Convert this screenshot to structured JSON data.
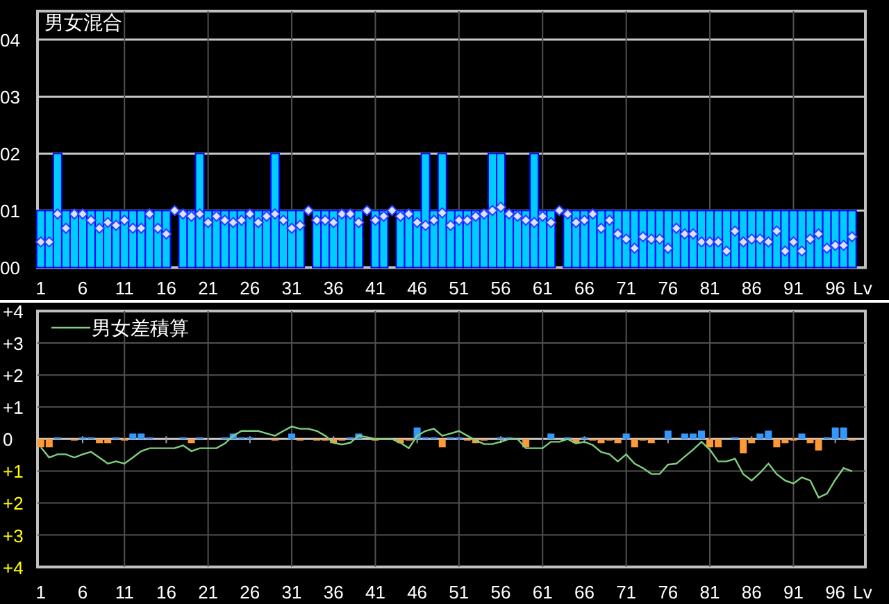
{
  "panels": [
    {
      "chart_data": {
        "type": "bar",
        "title": "男女混合",
        "grid": true,
        "x": [
          1,
          2,
          3,
          4,
          5,
          6,
          7,
          8,
          9,
          10,
          11,
          12,
          13,
          14,
          15,
          16,
          17,
          18,
          19,
          20,
          21,
          22,
          23,
          24,
          25,
          26,
          27,
          28,
          29,
          30,
          31,
          32,
          33,
          34,
          35,
          36,
          37,
          38,
          39,
          40,
          41,
          42,
          43,
          44,
          45,
          46,
          47,
          48,
          49,
          50,
          51,
          52,
          53,
          54,
          55,
          56,
          57,
          58,
          59,
          60,
          61,
          62,
          63,
          64,
          65,
          66,
          67,
          68,
          69,
          70,
          71,
          72,
          73,
          74,
          75,
          76,
          77,
          78,
          79,
          80,
          81,
          82,
          83,
          84,
          85,
          86,
          87,
          88,
          89,
          90,
          91,
          92,
          93,
          94,
          95,
          96,
          97,
          98
        ],
        "xlim": [
          0.6,
          99.6
        ],
        "xticks": [
          1,
          6,
          11,
          16,
          21,
          26,
          31,
          36,
          41,
          46,
          51,
          56,
          61,
          66,
          71,
          76,
          81,
          86,
          91,
          96
        ],
        "xlabel": "Lv",
        "ylim": [
          0,
          4.5
        ],
        "yticks": [
          {
            "value": 0,
            "label": "00"
          },
          {
            "value": 1,
            "label": "01"
          },
          {
            "value": 2,
            "label": "02"
          },
          {
            "value": 3,
            "label": "03"
          },
          {
            "value": 4,
            "label": "04"
          }
        ],
        "series": [
          {
            "color": "#00ccff",
            "values": [
              1,
              1,
              2,
              1,
              1,
              1,
              1,
              1,
              1,
              1,
              1,
              1,
              1,
              1,
              1,
              1,
              0,
              1,
              1,
              2,
              1,
              1,
              1,
              1,
              1,
              1,
              1,
              1,
              2,
              1,
              1,
              1,
              0,
              1,
              1,
              1,
              1,
              1,
              1,
              0,
              1,
              1,
              0,
              1,
              1,
              1,
              2,
              1,
              2,
              1,
              1,
              1,
              1,
              1,
              2,
              2,
              1,
              1,
              1,
              2,
              1,
              1,
              0,
              1,
              1,
              1,
              1,
              1,
              1,
              1,
              1,
              1,
              1,
              1,
              1,
              1,
              1,
              1,
              1,
              1,
              1,
              1,
              1,
              1,
              1,
              1,
              1,
              1,
              1,
              1,
              1,
              1,
              1,
              1,
              1,
              1,
              1,
              1
            ]
          },
          {
            "type": "scatter",
            "color": "#d8e4ff",
            "values": [
              0.45,
              0.45,
              0.94,
              0.69,
              0.94,
              0.94,
              0.83,
              0.69,
              0.79,
              0.74,
              0.83,
              0.69,
              0.69,
              0.94,
              0.69,
              0.59,
              1.0,
              0.94,
              0.9,
              0.94,
              0.79,
              0.9,
              0.83,
              0.79,
              0.83,
              0.94,
              0.79,
              0.9,
              0.94,
              0.83,
              0.69,
              0.74,
              1.0,
              0.83,
              0.83,
              0.79,
              0.94,
              0.94,
              0.79,
              1.0,
              0.83,
              0.9,
              1.0,
              0.9,
              0.94,
              0.79,
              0.74,
              0.83,
              0.96,
              0.74,
              0.83,
              0.83,
              0.9,
              0.94,
              1.0,
              1.06,
              0.94,
              0.9,
              0.83,
              0.79,
              0.9,
              0.79,
              1.0,
              0.94,
              0.79,
              0.83,
              0.94,
              0.69,
              0.83,
              0.59,
              0.5,
              0.34,
              0.54,
              0.5,
              0.5,
              0.34,
              0.69,
              0.59,
              0.59,
              0.45,
              0.45,
              0.45,
              0.29,
              0.64,
              0.45,
              0.5,
              0.5,
              0.45,
              0.64,
              0.29,
              0.45,
              0.29,
              0.5,
              0.59,
              0.34,
              0.39,
              0.39,
              0.54
            ]
          }
        ]
      }
    },
    {
      "chart_data": {
        "type": "bar",
        "grid": true,
        "x": [
          1,
          2,
          3,
          4,
          5,
          6,
          7,
          8,
          9,
          10,
          11,
          12,
          13,
          14,
          15,
          16,
          17,
          18,
          19,
          20,
          21,
          22,
          23,
          24,
          25,
          26,
          27,
          28,
          29,
          30,
          31,
          32,
          33,
          34,
          35,
          36,
          37,
          38,
          39,
          40,
          41,
          42,
          43,
          44,
          45,
          46,
          47,
          48,
          49,
          50,
          51,
          52,
          53,
          54,
          55,
          56,
          57,
          58,
          59,
          60,
          61,
          62,
          63,
          64,
          65,
          66,
          67,
          68,
          69,
          70,
          71,
          72,
          73,
          74,
          75,
          76,
          77,
          78,
          79,
          80,
          81,
          82,
          83,
          84,
          85,
          86,
          87,
          88,
          89,
          90,
          91,
          92,
          93,
          94,
          95,
          96,
          97,
          98
        ],
        "xlim": [
          0.6,
          99.6
        ],
        "xticks": [
          1,
          6,
          11,
          16,
          21,
          26,
          31,
          36,
          41,
          46,
          51,
          56,
          61,
          66,
          71,
          76,
          81,
          86,
          91,
          96
        ],
        "xlabel": "Lv",
        "ylim": [
          -4,
          4
        ],
        "yticks": [
          {
            "value": 4,
            "label": "+4"
          },
          {
            "value": 3,
            "label": "+3"
          },
          {
            "value": 2,
            "label": "+2"
          },
          {
            "value": 1,
            "label": "+1"
          },
          {
            "value": 0,
            "label": "0"
          },
          {
            "value": -1,
            "label": "+1"
          },
          {
            "value": -2,
            "label": "+2"
          },
          {
            "value": -3,
            "label": "+3"
          },
          {
            "value": -4,
            "label": "+4"
          }
        ],
        "series": [
          {
            "color": "#3399ff",
            "values": [
              null,
              null,
              0.05,
              null,
              null,
              0.05,
              0.05,
              null,
              null,
              0.05,
              null,
              0.17,
              0.17,
              0.05,
              null,
              null,
              null,
              0.05,
              null,
              0.05,
              null,
              null,
              0.05,
              0.17,
              0.05,
              0.05,
              null,
              null,
              null,
              null,
              0.17,
              null,
              null,
              null,
              null,
              null,
              null,
              0.05,
              0.17,
              null,
              null,
              null,
              null,
              null,
              null,
              0.36,
              0.05,
              0.05,
              null,
              0.05,
              0.05,
              null,
              null,
              null,
              null,
              0.05,
              0.05,
              null,
              null,
              null,
              null,
              0.17,
              null,
              0.05,
              null,
              0.05,
              null,
              null,
              null,
              null,
              0.17,
              null,
              null,
              null,
              null,
              0.26,
              null,
              0.17,
              0.17,
              0.26,
              null,
              null,
              null,
              0.05,
              null,
              null,
              0.17,
              0.26,
              null,
              null,
              null,
              0.17,
              null,
              null,
              0.05,
              0.36,
              0.36,
              null
            ]
          },
          {
            "color": "#ff9933",
            "values": [
              -0.26,
              -0.26,
              null,
              null,
              -0.05,
              null,
              null,
              -0.13,
              -0.13,
              null,
              -0.05,
              null,
              null,
              null,
              null,
              null,
              null,
              null,
              -0.13,
              null,
              null,
              null,
              null,
              null,
              null,
              null,
              null,
              null,
              -0.05,
              null,
              null,
              -0.05,
              null,
              -0.05,
              -0.05,
              -0.13,
              -0.05,
              null,
              null,
              null,
              -0.05,
              null,
              null,
              -0.13,
              -0.05,
              null,
              null,
              null,
              -0.26,
              null,
              null,
              -0.05,
              -0.13,
              -0.05,
              null,
              null,
              null,
              null,
              -0.26,
              null,
              null,
              null,
              null,
              null,
              -0.13,
              null,
              -0.05,
              -0.13,
              -0.05,
              -0.13,
              null,
              -0.26,
              -0.05,
              -0.13,
              null,
              null,
              null,
              null,
              null,
              null,
              -0.26,
              -0.26,
              null,
              null,
              -0.45,
              -0.13,
              null,
              null,
              -0.26,
              -0.13,
              -0.05,
              null,
              -0.13,
              -0.36,
              null,
              null,
              null,
              -0.05
            ]
          },
          {
            "type": "line",
            "name": "男女差積算",
            "color": "#80d080",
            "values": [
              -0.26,
              -0.58,
              -0.48,
              -0.48,
              -0.58,
              -0.48,
              -0.4,
              -0.58,
              -0.77,
              -0.7,
              -0.77,
              -0.58,
              -0.38,
              -0.29,
              -0.29,
              -0.29,
              -0.29,
              -0.2,
              -0.38,
              -0.29,
              -0.29,
              -0.29,
              -0.14,
              0.1,
              0.25,
              0.25,
              0.25,
              0.17,
              0.1,
              0.25,
              0.39,
              0.32,
              0.32,
              0.25,
              0.1,
              -0.12,
              -0.17,
              -0.12,
              0.1,
              0.06,
              0,
              0,
              0,
              -0.12,
              -0.29,
              0.1,
              0.25,
              0.32,
              0.1,
              0.17,
              0.25,
              0.1,
              -0.04,
              -0.16,
              -0.16,
              -0.09,
              0,
              0,
              -0.29,
              -0.29,
              -0.29,
              -0.09,
              -0.09,
              0,
              -0.14,
              -0.09,
              -0.19,
              -0.41,
              -0.48,
              -0.7,
              -0.48,
              -0.77,
              -0.91,
              -1.09,
              -1.09,
              -0.8,
              -0.77,
              -0.55,
              -0.33,
              -0.09,
              -0.33,
              -0.7,
              -0.7,
              -0.62,
              -1.1,
              -1.3,
              -1.06,
              -0.77,
              -1.1,
              -1.3,
              -1.39,
              -1.2,
              -1.3,
              -1.83,
              -1.71,
              -1.28,
              -0.91,
              -1.01
            ]
          }
        ]
      }
    }
  ]
}
